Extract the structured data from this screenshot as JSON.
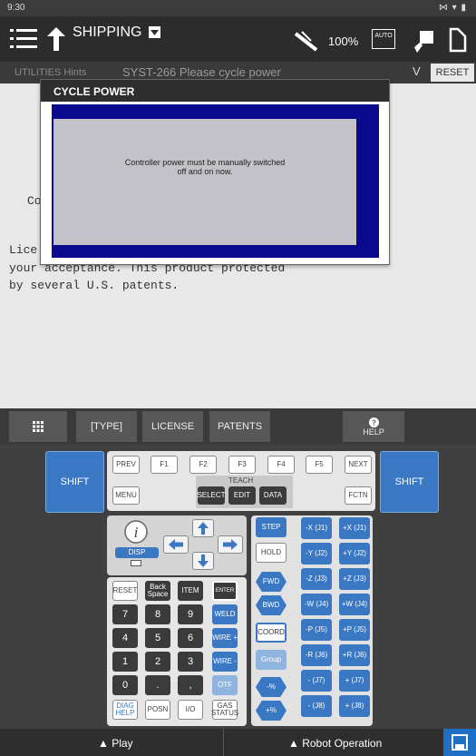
{
  "status": {
    "time": "9:30",
    "right_icons": "⋈ ▾ ▮"
  },
  "appbar": {
    "title": "SHIPPING",
    "override": "100%",
    "auto": "AUTO"
  },
  "message": {
    "hint": "UTILITIES Hints",
    "alarm": "SYST-266  Please cycle power",
    "expand": "V",
    "reset": "RESET"
  },
  "content": {
    "line1": "Co",
    "line2": "Lice",
    "line3": "your acceptance. This product protected",
    "line4": "by several U.S. patents."
  },
  "dialog": {
    "title": "CYCLE POWER",
    "msg1": "Controller power must be manually switched",
    "msg2": "off and on now."
  },
  "fkeys": {
    "type": "[TYPE]",
    "license": "LICENSE",
    "patents": "PATENTS",
    "help": "HELP"
  },
  "keys": {
    "shift": "SHIFT",
    "prev": "PREV",
    "f1": "F1",
    "f2": "F2",
    "f3": "F3",
    "f4": "F4",
    "f5": "F5",
    "next": "NEXT",
    "menu": "MENU",
    "teach": "TEACH",
    "select": "SELECT",
    "edit": "EDIT",
    "data": "DATA",
    "fctn": "FCTN",
    "disp": "DISP",
    "step": "STEP",
    "hold": "HOLD",
    "fwd": "FWD",
    "bwd": "BWD",
    "coord": "COORD",
    "group": "Group",
    "reset": "RESET",
    "backspace": "Back Space",
    "item": "ITEM",
    "enter": "ENTER",
    "weld": "WELD",
    "wire_plus": "WIRE +",
    "wire_minus": "WIRE -",
    "otf": "OTF",
    "n7": "7",
    "n8": "8",
    "n9": "9",
    "n4": "4",
    "n5": "5",
    "n6": "6",
    "n1": "1",
    "n2": "2",
    "n3": "3",
    "n0": "0",
    "dot": ".",
    "comma": ",",
    "diag": "DIAG HELP",
    "posn": "POSN",
    "io": "I/O",
    "gas": "GAS STATUS",
    "slow": "-%",
    "fast": "+%",
    "jog": [
      [
        "-X (J1)",
        "+X (J1)"
      ],
      [
        "-Y (J2)",
        "+Y (J2)"
      ],
      [
        "-Z (J3)",
        "+Z (J3)"
      ],
      [
        "-W (J4)",
        "+W (J4)"
      ],
      [
        "-P (J5)",
        "+P (J5)"
      ],
      [
        "-R (J6)",
        "+R (J6)"
      ],
      [
        "- (J7)",
        "+ (J7)"
      ],
      [
        "- (J8)",
        "+ (J8)"
      ]
    ]
  },
  "bottom": {
    "play": "▲ Play",
    "robot": "▲ Robot Operation"
  },
  "icons": [
    "menu-icon",
    "back-icon",
    "dropdown-icon",
    "tool-icon",
    "auto-icon",
    "teach-pendant-icon",
    "fullscreen-icon",
    "grid-icon",
    "info-icon",
    "arrow-icons",
    "save-icon"
  ]
}
